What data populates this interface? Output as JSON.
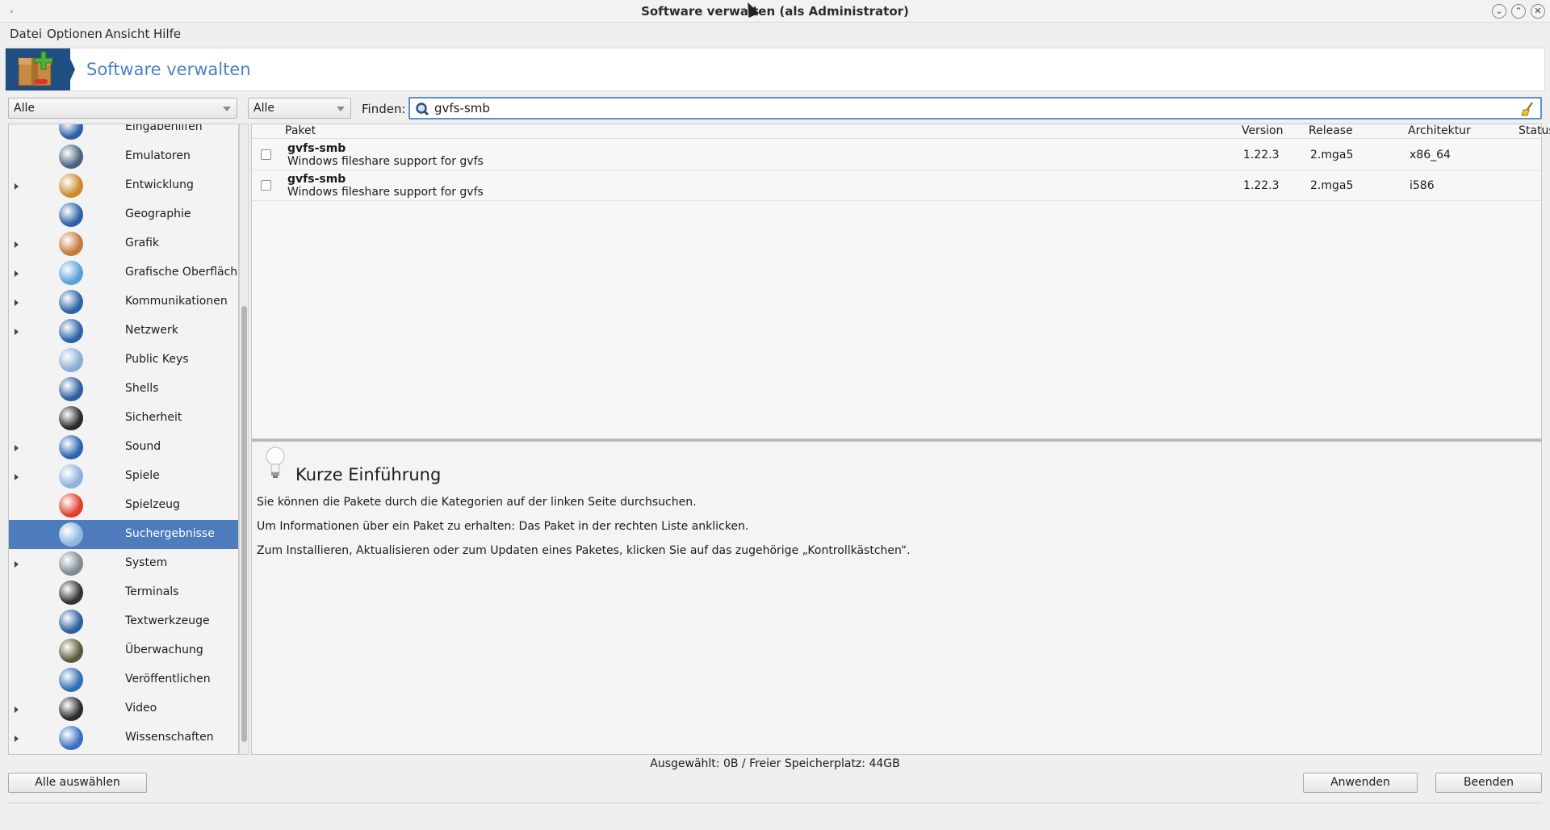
{
  "window": {
    "title": "Software verwalten (als Administrator)"
  },
  "menubar": [
    {
      "label": "Datei"
    },
    {
      "label": "Optionen"
    },
    {
      "label": "Ansicht"
    },
    {
      "label": "Hilfe"
    }
  ],
  "banner": {
    "title": "Software verwalten"
  },
  "filters": {
    "group_combo": "Alle",
    "type_combo": "Alle",
    "find_label": "Finden:",
    "search_value": "gvfs-smb"
  },
  "sidebar": {
    "categories": [
      {
        "label": "Eingabehilfen",
        "expandable": false,
        "icon": "accessibility-icon",
        "color": "#2d5fa8"
      },
      {
        "label": "Emulatoren",
        "expandable": false,
        "icon": "emulator-icon",
        "color": "#4a6480"
      },
      {
        "label": "Entwicklung",
        "expandable": true,
        "icon": "hammer-icon",
        "color": "#c98a2e"
      },
      {
        "label": "Geographie",
        "expandable": false,
        "icon": "globe-icon",
        "color": "#2e62a5"
      },
      {
        "label": "Grafik",
        "expandable": true,
        "icon": "palette-icon",
        "color": "#c47a3a"
      },
      {
        "label": "Grafische Oberfläche",
        "expandable": true,
        "icon": "monitor-icon",
        "color": "#5aa0d8"
      },
      {
        "label": "Kommunikationen",
        "expandable": true,
        "icon": "globe-icon",
        "color": "#2e62a5"
      },
      {
        "label": "Netzwerk",
        "expandable": true,
        "icon": "network-icon",
        "color": "#2e62a5"
      },
      {
        "label": "Public Keys",
        "expandable": false,
        "icon": "keys-icon",
        "color": "#8aaed6"
      },
      {
        "label": "Shells",
        "expandable": false,
        "icon": "shell-icon",
        "color": "#2e5fa0"
      },
      {
        "label": "Sicherheit",
        "expandable": false,
        "icon": "police-icon",
        "color": "#2a2a2a"
      },
      {
        "label": "Sound",
        "expandable": true,
        "icon": "speaker-icon",
        "color": "#2b63b0"
      },
      {
        "label": "Spiele",
        "expandable": true,
        "icon": "cards-icon",
        "color": "#8fb2da"
      },
      {
        "label": "Spielzeug",
        "expandable": false,
        "icon": "ball-icon",
        "color": "#e0402a"
      },
      {
        "label": "Suchergebnisse",
        "expandable": false,
        "icon": "search-results-icon",
        "color": "#8fb6de",
        "selected": true
      },
      {
        "label": "System",
        "expandable": true,
        "icon": "tools-icon",
        "color": "#7d8a96"
      },
      {
        "label": "Terminals",
        "expandable": false,
        "icon": "terminal-icon",
        "color": "#333333"
      },
      {
        "label": "Textwerkzeuge",
        "expandable": false,
        "icon": "text-tools-icon",
        "color": "#2e5fa0"
      },
      {
        "label": "Überwachung",
        "expandable": false,
        "icon": "monitoring-icon",
        "color": "#5b5b3a"
      },
      {
        "label": "Veröffentlichen",
        "expandable": false,
        "icon": "publishing-icon",
        "color": "#2f6fb3"
      },
      {
        "label": "Video",
        "expandable": true,
        "icon": "video-icon",
        "color": "#2c2c2c"
      },
      {
        "label": "Wissenschaften",
        "expandable": true,
        "icon": "flask-icon",
        "color": "#3a6fc0"
      }
    ]
  },
  "packages": {
    "columns": [
      "Paket",
      "Version",
      "Release",
      "Architektur",
      "Status"
    ],
    "rows": [
      {
        "name": "gvfs-smb",
        "description": "Windows fileshare support for gvfs",
        "version": "1.22.3",
        "release": "2.mga5",
        "arch": "x86_64",
        "status": ""
      },
      {
        "name": "gvfs-smb",
        "description": "Windows fileshare support for gvfs",
        "version": "1.22.3",
        "release": "2.mga5",
        "arch": "i586",
        "status": ""
      }
    ]
  },
  "info": {
    "title": "Kurze Einführung",
    "lines": [
      "Sie können die Pakete durch die Kategorien auf der linken Seite durchsuchen.",
      "Um Informationen über ein Paket zu erhalten: Das Paket in der rechten Liste anklicken.",
      "Zum Installieren, Aktualisieren oder zum Updaten eines Paketes, klicken Sie auf das zugehörige „Kontrollkästchen“."
    ]
  },
  "status_text": "Ausgewählt: 0B / Freier Speicherplatz: 44GB",
  "buttons": {
    "select_all": "Alle auswählen",
    "apply": "Anwenden",
    "quit": "Beenden"
  },
  "colors": {
    "accent": "#4d7bbb",
    "banner_title": "#4b82c2",
    "logo_bg": "#1f4f82"
  }
}
